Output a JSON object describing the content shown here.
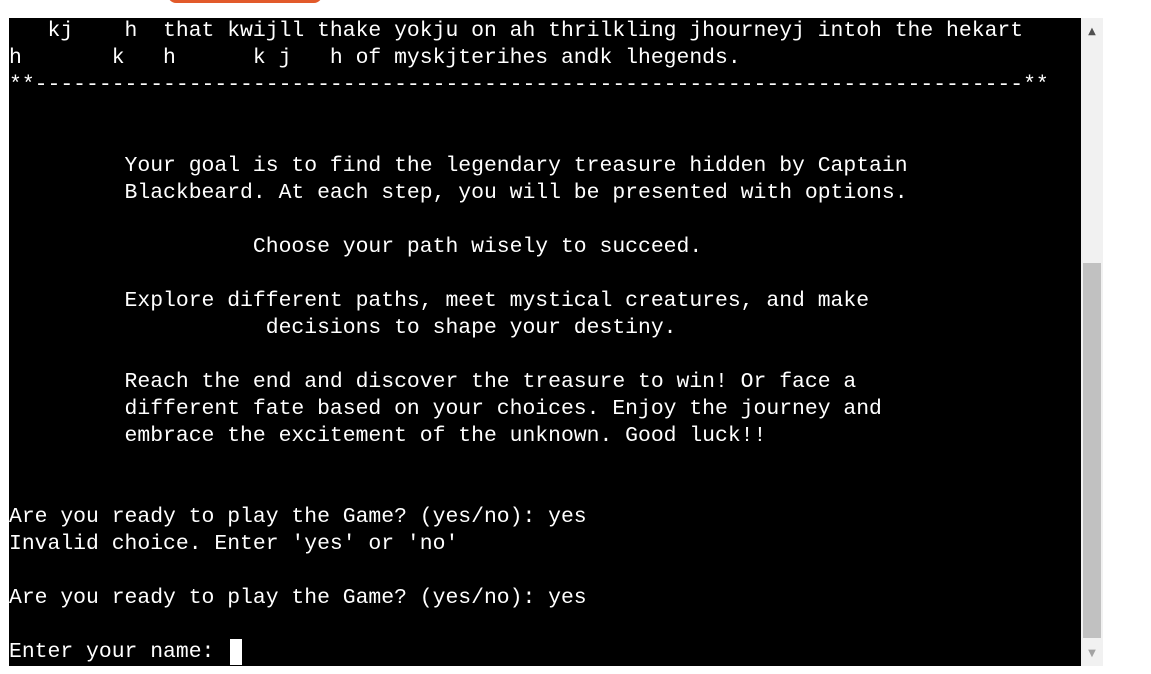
{
  "terminal": {
    "lines": [
      "   kj    h  that kwijll thake yokju on ah thrilkling jhourneyj intoh the hekart",
      "h       k   h      k j   h of myskjterihes andk lhegends.",
      "**-----------------------------------------------------------------------------**",
      "",
      "",
      "         Your goal is to find the legendary treasure hidden by Captain",
      "         Blackbeard. At each step, you will be presented with options.",
      "",
      "                   Choose your path wisely to succeed.",
      "",
      "         Explore different paths, meet mystical creatures, and make",
      "                    decisions to shape your destiny.",
      "",
      "         Reach the end and discover the treasure to win! Or face a",
      "         different fate based on your choices. Enjoy the journey and",
      "         embrace the excitement of the unknown. Good luck!!",
      "",
      "",
      "Are you ready to play the Game? (yes/no): yes",
      "Invalid choice. Enter 'yes' or 'no'",
      "",
      "Are you ready to play the Game? (yes/no): yes",
      "",
      "Enter your name: "
    ]
  },
  "scrollbar": {
    "up_icon": "triangle-up-icon",
    "down_icon": "triangle-down-icon"
  },
  "colors": {
    "terminal_bg": "#000000",
    "terminal_fg": "#ffffff",
    "accent_button": "#e25a2a"
  }
}
